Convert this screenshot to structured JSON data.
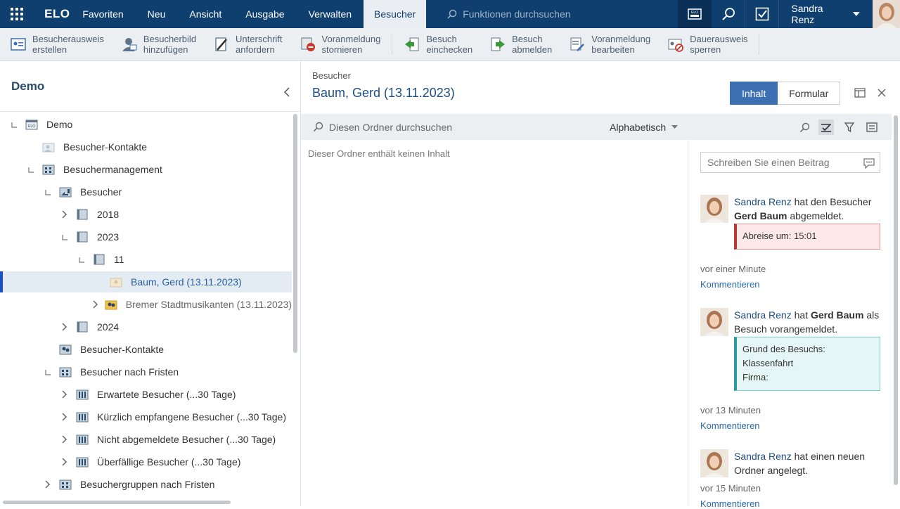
{
  "topbar": {
    "logo": "ELO",
    "menu": [
      "Favoriten",
      "Neu",
      "Ansicht",
      "Ausgabe",
      "Verwalten",
      "Besucher"
    ],
    "active_menu": "Besucher",
    "search_placeholder": "Funktionen durchsuchen",
    "user": "Sandra Renz"
  },
  "ribbon": {
    "items": [
      {
        "l1": "Besucherausweis",
        "l2": "erstellen",
        "icon": "badge-icon"
      },
      {
        "l1": "Besucherbild",
        "l2": "hinzufügen",
        "icon": "person-photo-icon"
      },
      {
        "l1": "Unterschrift",
        "l2": "anfordern",
        "icon": "signature-icon"
      },
      {
        "l1": "Voranmeldung",
        "l2": "stornieren",
        "icon": "cancel-registration-icon"
      },
      {
        "l1": "Besuch",
        "l2": "einchecken",
        "icon": "check-in-icon"
      },
      {
        "l1": "Besuch",
        "l2": "abmelden",
        "icon": "check-out-icon"
      },
      {
        "l1": "Voranmeldung",
        "l2": "bearbeiten",
        "icon": "edit-registration-icon"
      },
      {
        "l1": "Dauerausweis",
        "l2": "sperren",
        "icon": "lock-badge-icon"
      }
    ]
  },
  "left": {
    "title": "Demo",
    "tree": [
      {
        "label": "Demo",
        "level": 0,
        "exp": "open",
        "icon": "repository-icon"
      },
      {
        "label": "Besucher-Kontakte",
        "level": 1,
        "exp": "none",
        "icon": "contacts-folder-icon"
      },
      {
        "label": "Besuchermanagement",
        "level": 1,
        "exp": "open",
        "icon": "building-folder-icon"
      },
      {
        "label": "Besucher",
        "level": 2,
        "exp": "open",
        "icon": "visitor-folder-icon"
      },
      {
        "label": "2018",
        "level": 3,
        "exp": "closed",
        "icon": "year-folder-icon"
      },
      {
        "label": "2023",
        "level": 3,
        "exp": "open",
        "icon": "year-folder-icon"
      },
      {
        "label": "11",
        "level": 4,
        "exp": "open",
        "icon": "month-folder-icon"
      },
      {
        "label": "Baum, Gerd (13.11.2023)",
        "level": 5,
        "exp": "none",
        "icon": "visitor-entry-icon",
        "selected": true
      },
      {
        "label": "Bremer Stadtmusikanten (13.11.2023)",
        "level": 5,
        "exp": "closed",
        "icon": "group-entry-icon",
        "grey": true
      },
      {
        "label": "2024",
        "level": 3,
        "exp": "closed",
        "icon": "year-folder-icon"
      },
      {
        "label": "Besucher-Kontakte",
        "level": 2,
        "exp": "none",
        "icon": "contacts-icon"
      },
      {
        "label": "Besucher nach Fristen",
        "level": 2,
        "exp": "open",
        "icon": "deadline-folder-icon"
      },
      {
        "label": "Erwartete Besucher (...30 Tage)",
        "level": 3,
        "exp": "closed",
        "icon": "search-folder-icon"
      },
      {
        "label": "Kürzlich empfangene Besucher (...30 Tage)",
        "level": 3,
        "exp": "closed",
        "icon": "search-folder-icon"
      },
      {
        "label": "Nicht abgemeldete Besucher (...30 Tage)",
        "level": 3,
        "exp": "closed",
        "icon": "search-folder-icon"
      },
      {
        "label": "Überfällige Besucher (...30 Tage)",
        "level": 3,
        "exp": "closed",
        "icon": "search-folder-icon"
      },
      {
        "label": "Besuchergruppen nach Fristen",
        "level": 2,
        "exp": "closed",
        "icon": "deadline-folder-icon"
      }
    ]
  },
  "main": {
    "breadcrumb": "Besucher",
    "title": "Baum, Gerd (13.11.2023)",
    "tab_content": "Inhalt",
    "tab_form": "Formular",
    "search_placeholder": "Diesen Ordner durchsuchen",
    "sort": "Alphabetisch",
    "empty": "Dieser Ordner enthält keinen Inhalt"
  },
  "feed": {
    "input_placeholder": "Schreiben Sie einen Beitrag",
    "entries": [
      {
        "user": "Sandra Renz",
        "pre": " hat den Besucher ",
        "bold": "Gerd Baum",
        "post": " abgemeldet.",
        "box": [
          "Abreise um: 15:01"
        ],
        "box_type": "red",
        "time": "vor einer Minute",
        "comment": "Kommentieren"
      },
      {
        "user": "Sandra Renz",
        "pre": " hat ",
        "bold": "Gerd Baum",
        "post": " als Besuch vorangemeldet.",
        "box": [
          "Grund des Besuchs:",
          "Klassenfahrt",
          "Firma:"
        ],
        "box_type": "teal",
        "time": "vor 13 Minuten",
        "comment": "Kommentieren"
      },
      {
        "user": "Sandra Renz",
        "pre": " hat einen neuen Ordner angelegt.",
        "bold": "",
        "post": "",
        "box": [],
        "box_type": "",
        "time": "vor 15 Minuten",
        "comment": "Kommentieren"
      }
    ]
  },
  "colors": {
    "topbar": "#0f3f6f",
    "accent": "#3d6fb3",
    "selection": "#e3ebf3"
  }
}
